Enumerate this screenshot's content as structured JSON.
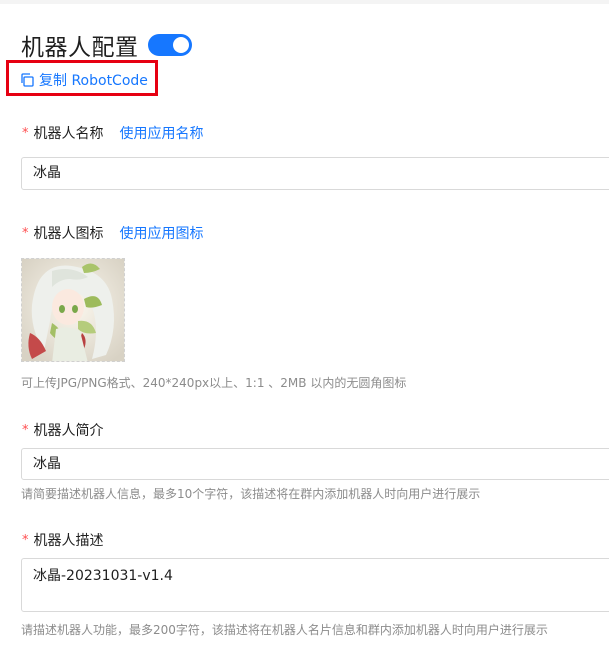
{
  "header": {
    "title": "机器人配置",
    "toggle_on": true,
    "copy_label": "复制 RobotCode"
  },
  "fields": {
    "name": {
      "required_mark": "*",
      "label": "机器人名称",
      "action": "使用应用名称",
      "value": "冰晶"
    },
    "icon": {
      "required_mark": "*",
      "label": "机器人图标",
      "action": "使用应用图标",
      "hint": "可上传JPG/PNG格式、240*240px以上、1:1 、2MB 以内的无圆角图标"
    },
    "intro": {
      "required_mark": "*",
      "label": "机器人简介",
      "value": "冰晶",
      "hint": "请简要描述机器人信息，最多10个字符，该描述将在群内添加机器人时向用户进行展示"
    },
    "desc": {
      "required_mark": "*",
      "label": "机器人描述",
      "value": "冰晶-20231031-v1.4",
      "hint": "请描述机器人功能，最多200字符，该描述将在机器人名片信息和群内添加机器人时向用户进行展示"
    }
  },
  "colors": {
    "accent": "#1677ff",
    "required": "#ff4d4f",
    "highlight_box": "#e60012"
  }
}
